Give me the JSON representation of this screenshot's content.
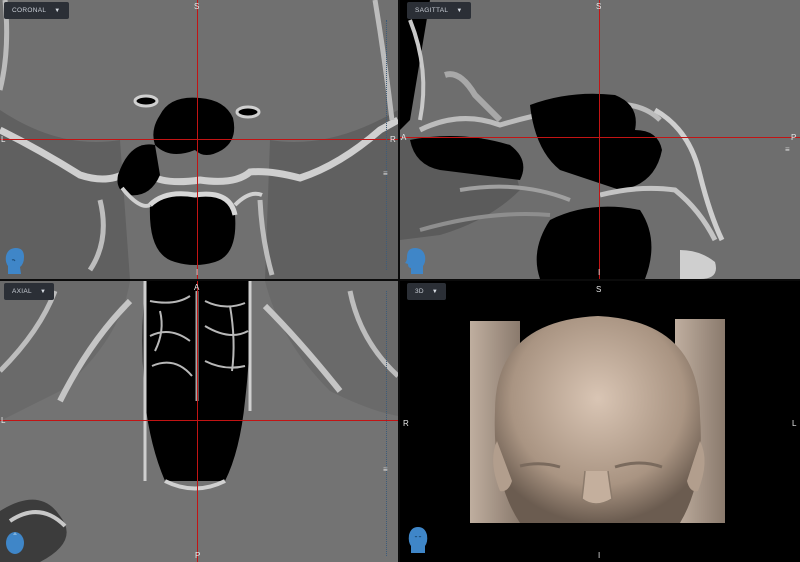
{
  "viewports": {
    "coronal": {
      "label": "CORONAL",
      "top": "S",
      "bottom": "I",
      "left": "L",
      "right": "R"
    },
    "sagittal": {
      "label": "SAGITTAL",
      "top": "S",
      "bottom": "I",
      "left": "A",
      "right": "P"
    },
    "axial": {
      "label": "AXIAL",
      "top": "A",
      "bottom": "P",
      "left": "L",
      "right": "R"
    },
    "three_d": {
      "label": "3D",
      "top": "S",
      "bottom": "I",
      "left": "R",
      "right": "L"
    }
  },
  "icons": {
    "dropdown": "chevron-down-icon",
    "orientation_head": "head-orientation-icon",
    "slice_slider": "slice-slider-icon"
  },
  "colors": {
    "crosshair": "#c21414",
    "head_icon": "#3f86c8",
    "dropdown_bg": "#2b2f36",
    "viewport_bg": "#000000"
  }
}
